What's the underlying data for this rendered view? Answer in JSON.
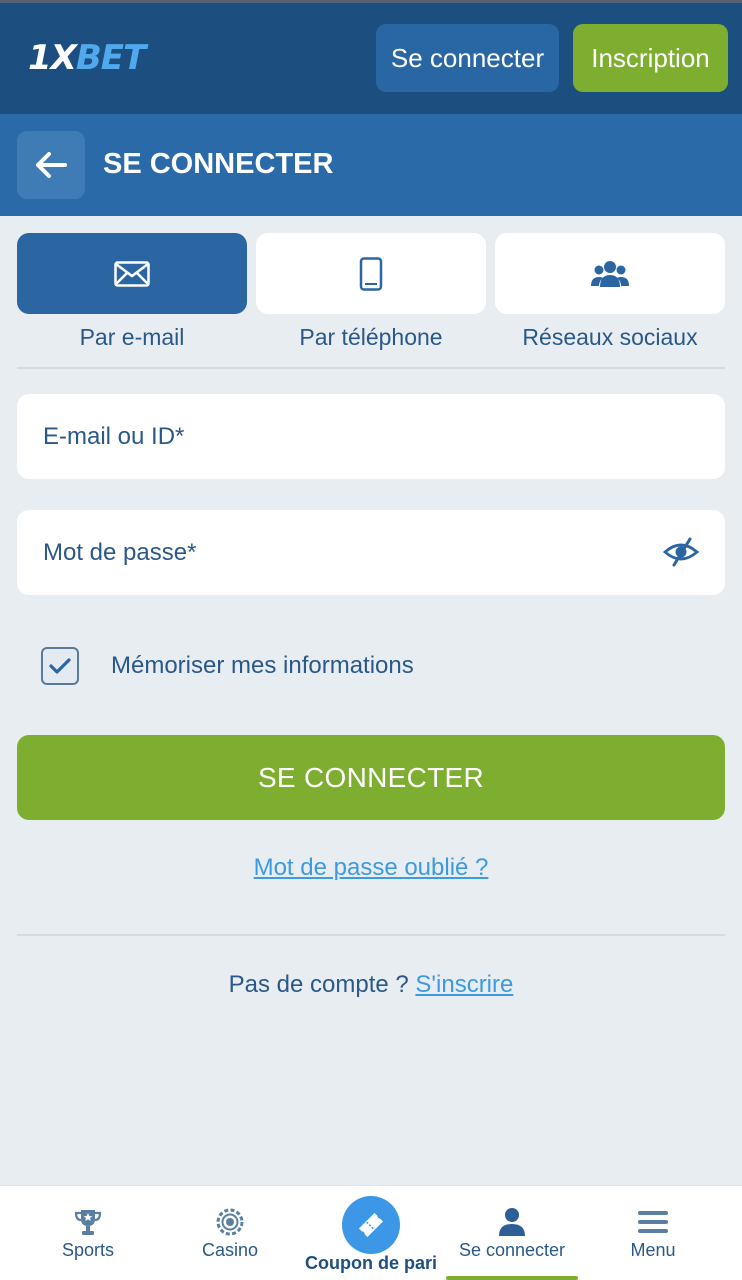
{
  "header": {
    "logo_prefix": "1X",
    "logo_suffix": "BET",
    "login_label": "Se connecter",
    "register_label": "Inscription"
  },
  "page": {
    "title": "SE CONNECTER"
  },
  "tabs": [
    {
      "label": "Par e-mail",
      "icon": "envelope-icon",
      "active": true
    },
    {
      "label": "Par téléphone",
      "icon": "phone-icon",
      "active": false
    },
    {
      "label": "Réseaux sociaux",
      "icon": "users-icon",
      "active": false
    }
  ],
  "form": {
    "email_placeholder": "E-mail ou ID*",
    "password_placeholder": "Mot de passe*",
    "remember_label": "Mémoriser mes informations",
    "remember_checked": true,
    "submit_label": "SE CONNECTER",
    "forgot_label": "Mot de passe oublié ?"
  },
  "signup": {
    "prompt": "Pas de compte ?",
    "link": "S'inscrire"
  },
  "bottom_nav": {
    "items": [
      {
        "label": "Sports",
        "icon": "trophy-icon"
      },
      {
        "label": "Casino",
        "icon": "casino-chip-icon"
      },
      {
        "label": "Coupon de pari",
        "icon": "ticket-icon"
      },
      {
        "label": "Se connecter",
        "icon": "user-icon"
      },
      {
        "label": "Menu",
        "icon": "menu-icon"
      }
    ]
  },
  "colors": {
    "header_bg": "#1d4e80",
    "title_bg": "#2b6aa8",
    "accent_green": "#7eae2f",
    "link_blue": "#3c9ae0",
    "text_blue": "#2a5888"
  }
}
